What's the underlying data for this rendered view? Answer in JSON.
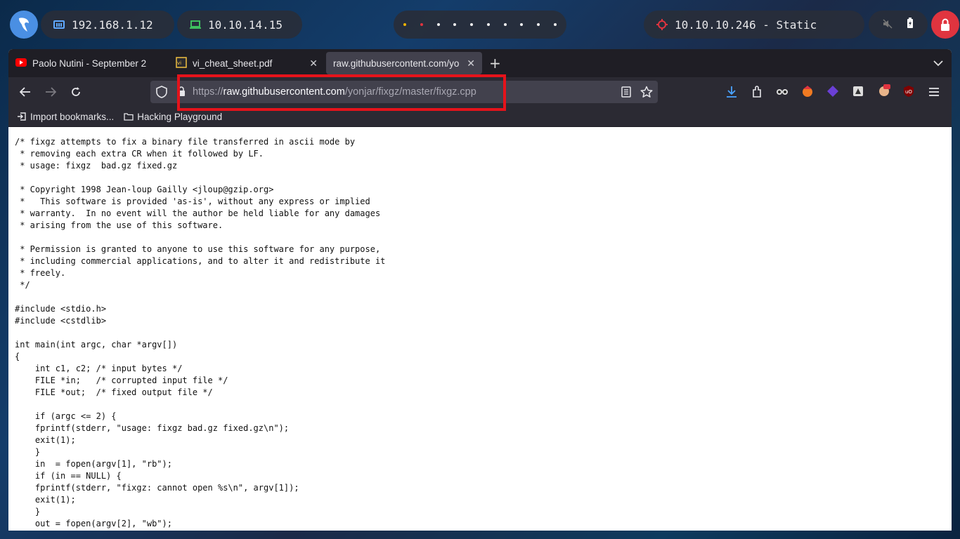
{
  "topbar": {
    "ip_local": "192.168.1.12",
    "ip_vpn": "10.10.14.15",
    "target": "10.10.10.246 - Static",
    "colors": {
      "launcher": "#4a8fe3",
      "lock": "#e0343f",
      "target_icon": "#e0343f",
      "vpn_icon": "#3fbf5f",
      "net_icon": "#5fa8ff"
    }
  },
  "tabs": [
    {
      "title": "Paolo Nutini - September 2",
      "icon": "youtube-icon"
    },
    {
      "title": "vi_cheat_sheet.pdf",
      "icon": "pdf-icon"
    },
    {
      "title": "raw.githubusercontent.com/yo",
      "icon": "none"
    }
  ],
  "url": {
    "scheme": "https://",
    "host": "raw.githubusercontent.com",
    "path": "/yonjar/fixgz/master/fixgz.cpp"
  },
  "bookmarks": [
    {
      "label": "Import bookmarks...",
      "icon": "import-icon"
    },
    {
      "label": "Hacking Playground",
      "icon": "folder-icon"
    }
  ],
  "code": "/* fixgz attempts to fix a binary file transferred in ascii mode by\n * removing each extra CR when it followed by LF.\n * usage: fixgz  bad.gz fixed.gz\n\n * Copyright 1998 Jean-loup Gailly <jloup@gzip.org>\n *   This software is provided 'as-is', without any express or implied\n * warranty.  In no event will the author be held liable for any damages\n * arising from the use of this software.\n\n * Permission is granted to anyone to use this software for any purpose,\n * including commercial applications, and to alter it and redistribute it\n * freely.\n */\n\n#include <stdio.h>\n#include <cstdlib>\n\nint main(int argc, char *argv[])\n{\n    int c1, c2; /* input bytes */\n    FILE *in;   /* corrupted input file */\n    FILE *out;  /* fixed output file */\n\n    if (argc <= 2) {\n    fprintf(stderr, \"usage: fixgz bad.gz fixed.gz\\n\");\n    exit(1);\n    }\n    in  = fopen(argv[1], \"rb\");\n    if (in == NULL) {\n    fprintf(stderr, \"fixgz: cannot open %s\\n\", argv[1]);\n    exit(1);\n    }\n    out = fopen(argv[2], \"wb\");"
}
